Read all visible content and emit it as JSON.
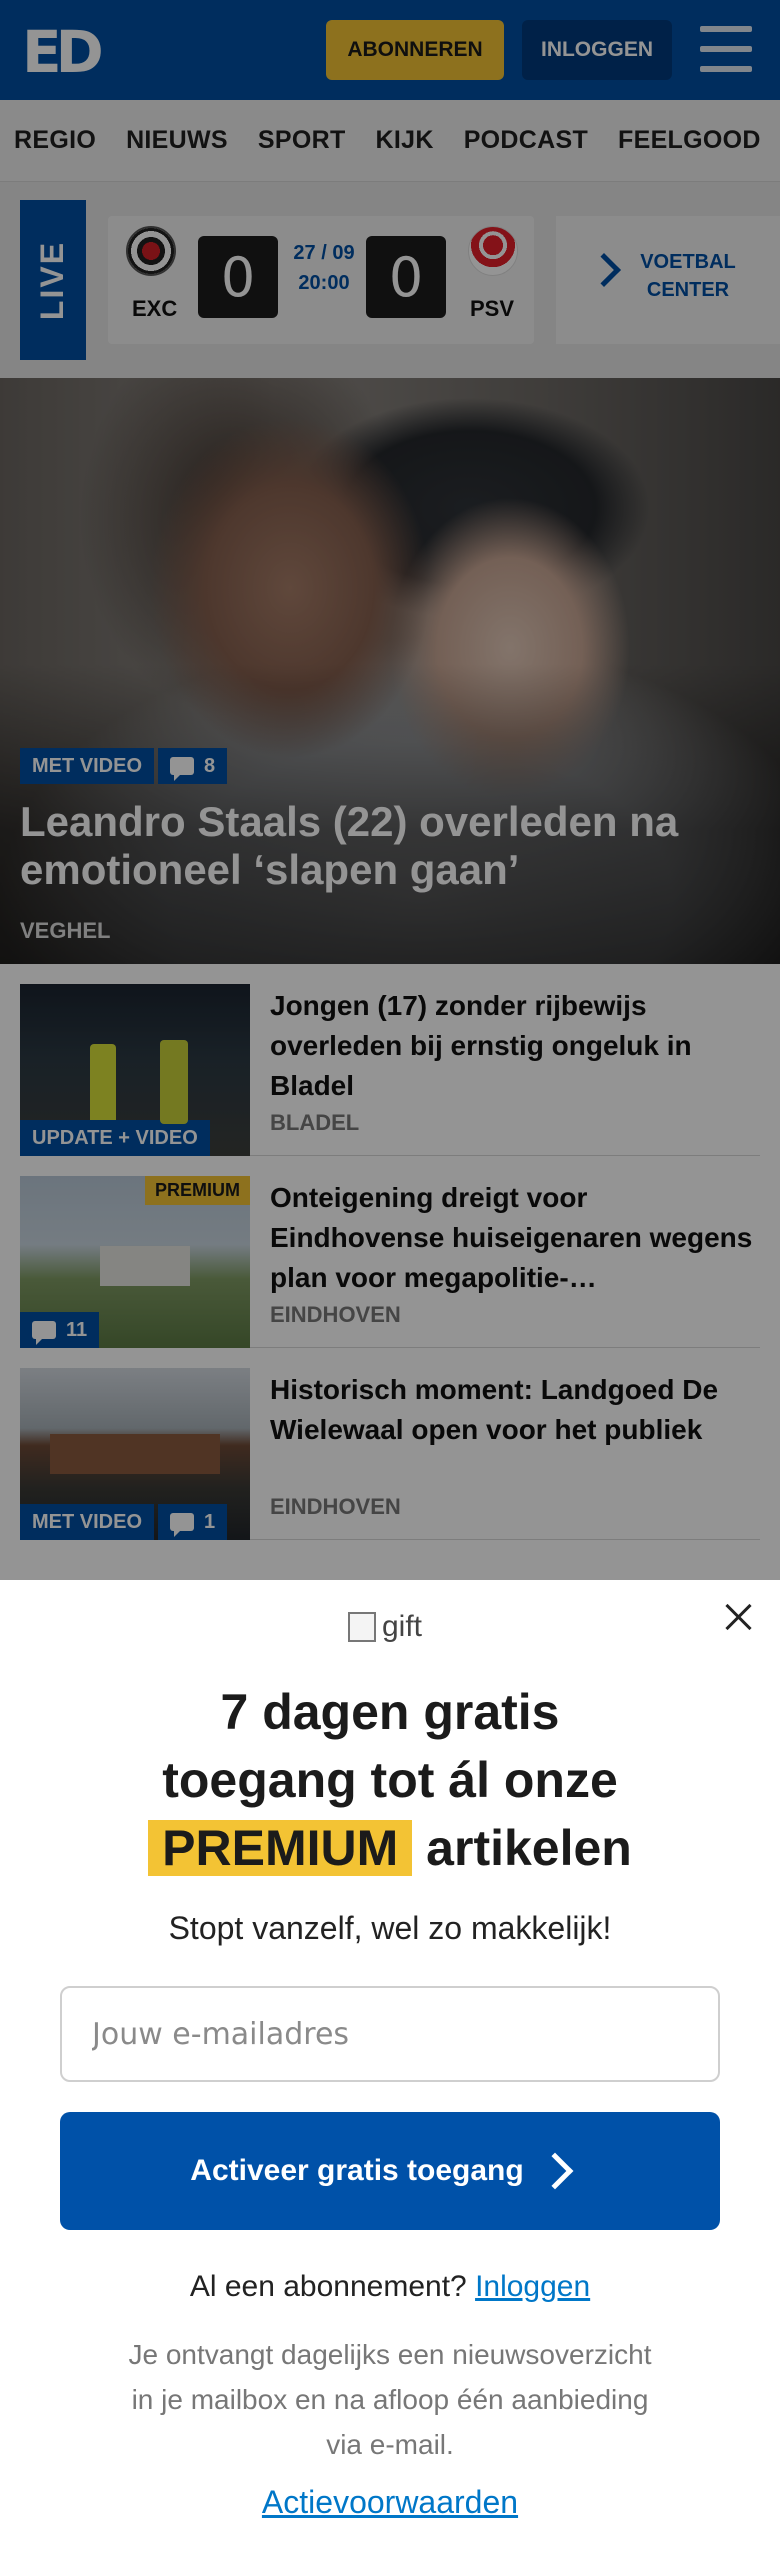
{
  "header": {
    "logo": "ED",
    "subscribe_label": "ABONNEREN",
    "login_label": "INLOGGEN"
  },
  "nav": {
    "items": [
      "REGIO",
      "NIEUWS",
      "SPORT",
      "KIJK",
      "PODCAST",
      "FEELGOOD"
    ]
  },
  "live": {
    "tab_label": "LIVE",
    "home_team": "EXC",
    "away_team": "PSV",
    "home_score": "0",
    "away_score": "0",
    "date": "27 / 09",
    "time": "20:00",
    "voetbal_center": "VOETBAL CENTER"
  },
  "hero": {
    "video_badge": "MET VIDEO",
    "comments": "8",
    "title": "Leandro Staals (22) overleden na emotioneel ‘slapen gaan’",
    "location": "VEGHEL"
  },
  "articles": [
    {
      "title": "Jongen (17) zonder rijbewijs overleden bij ernstig ongeluk in Bladel",
      "location": "BLADEL",
      "badge": "UPDATE + VIDEO"
    },
    {
      "title": "Onteigening dreigt voor Eindhovense huiseigenaren wegens plan voor megapolitie-…",
      "location": "EINDHOVEN",
      "premium": "PREMIUM",
      "comments": "11"
    },
    {
      "title": "Historisch moment: Landgoed De Wielewaal open voor het publiek",
      "location": "EINDHOVEN",
      "badge": "MET VIDEO",
      "comments": "1"
    }
  ],
  "modal": {
    "gift_alt": "gift",
    "heading_line1": "7 dagen gratis",
    "heading_line2": "toegang tot ál onze",
    "heading_highlight": "PREMIUM",
    "heading_end": "artikelen",
    "subtitle": "Stopt vanzelf, wel zo makkelijk!",
    "email_placeholder": "Jouw e-mailadres",
    "cta_label": "Activeer gratis toegang",
    "cta_icon_alt": "arrow right",
    "already_text": "Al een abonnement?",
    "already_link": "Inloggen",
    "notice": "Je ontvangt dagelijks een nieuwsoverzicht in je mailbox en na afloop één aanbieding via e-mail.",
    "terms": "Actievoorwaarden"
  },
  "colors": {
    "brand_blue": "#004fa3",
    "premium_yellow": "#f3c334",
    "link_blue": "#0077c8"
  }
}
